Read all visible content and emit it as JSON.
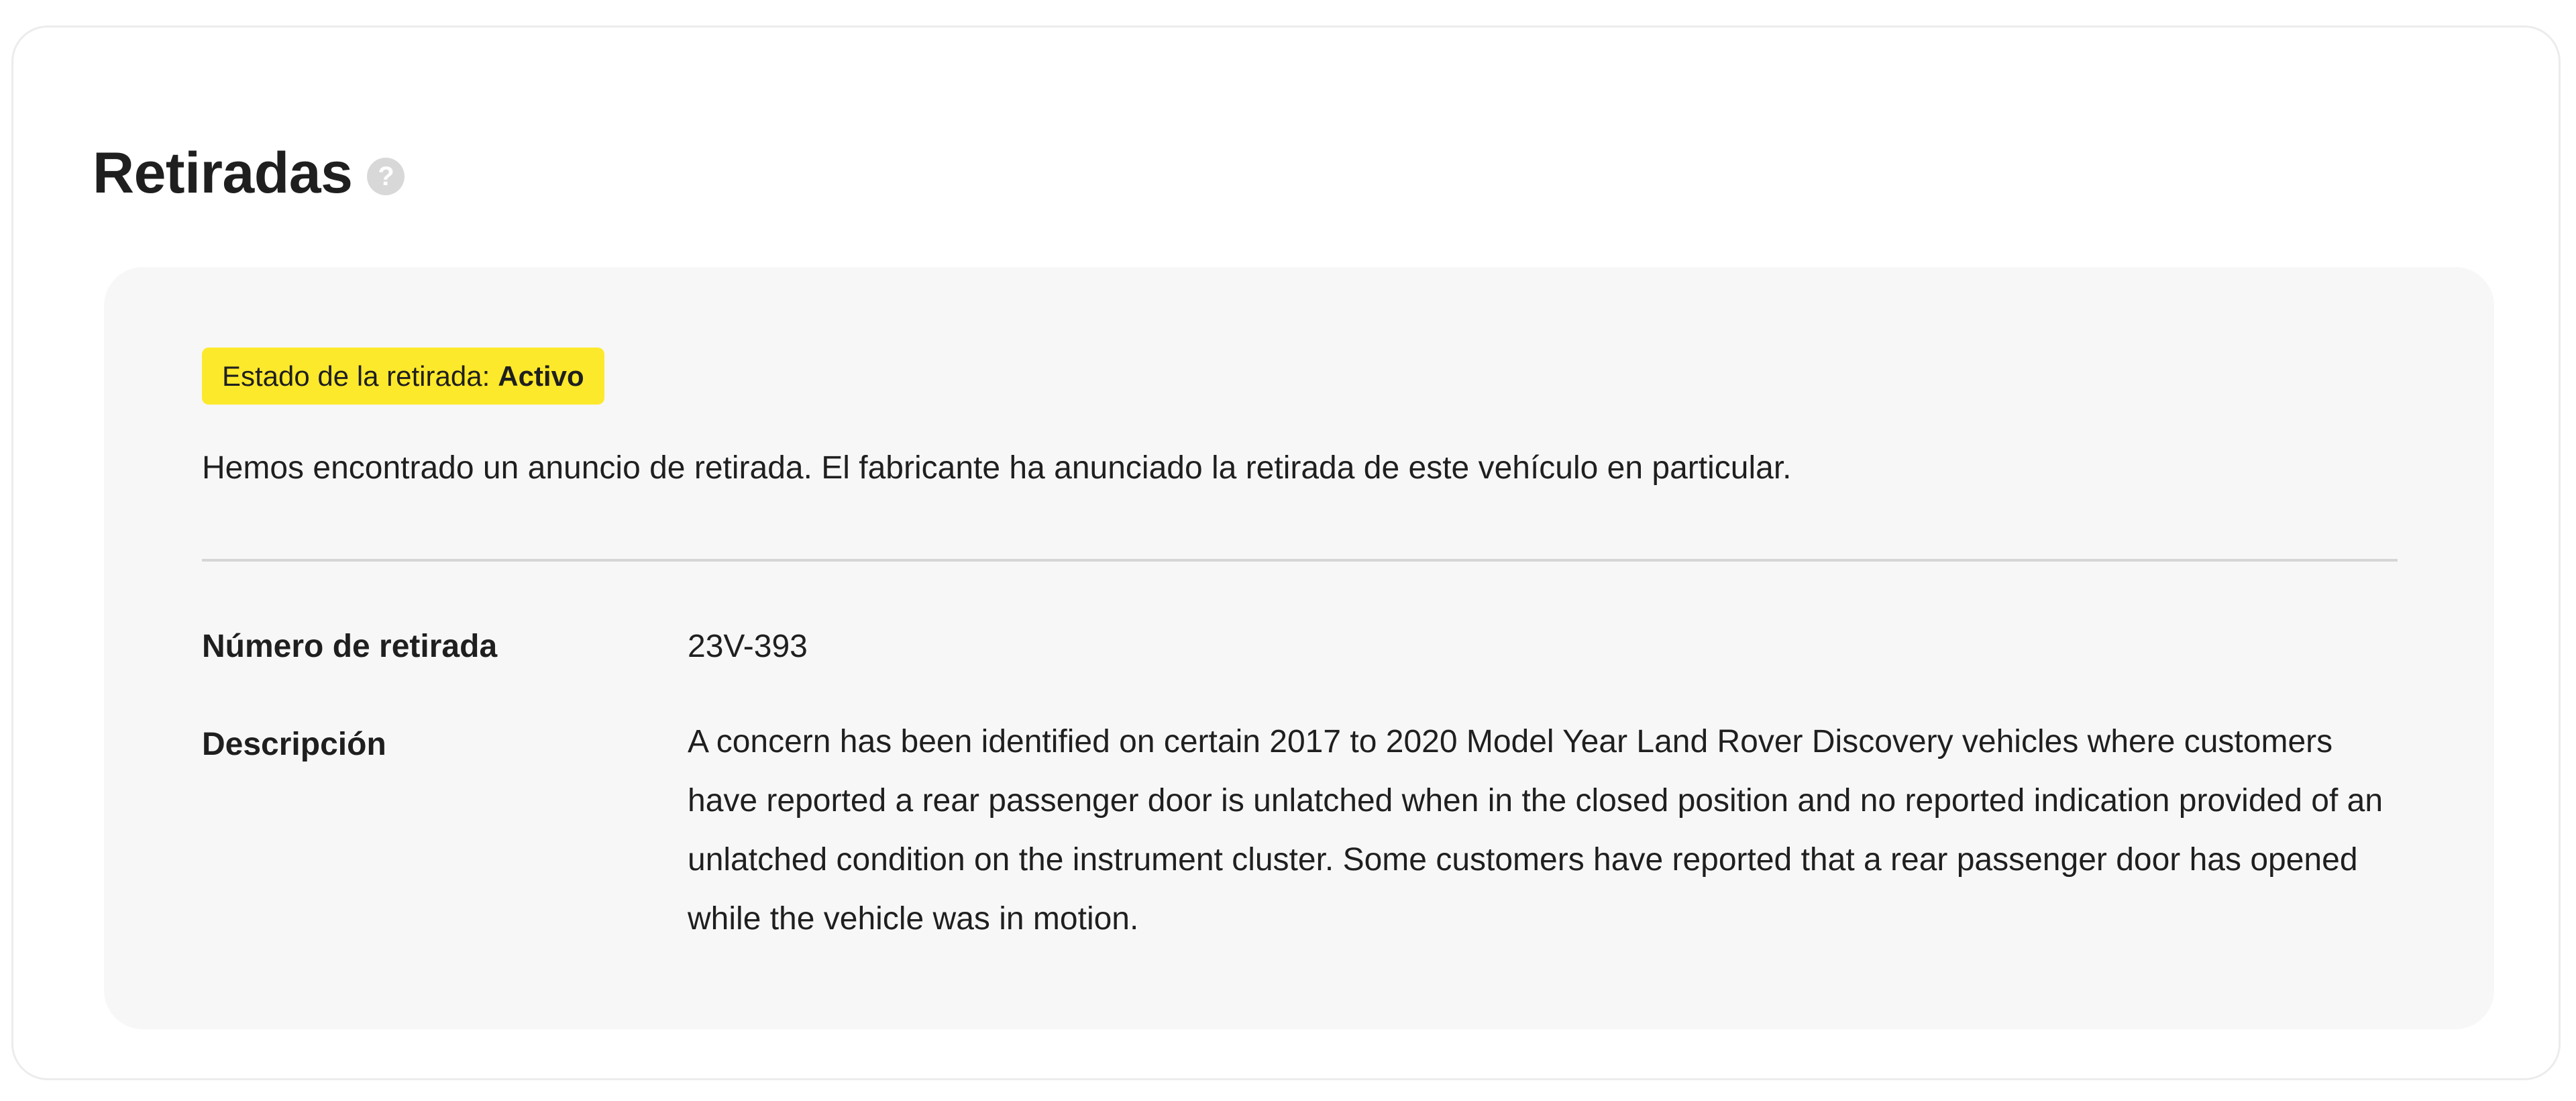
{
  "section": {
    "title": "Retiradas",
    "help_icon": "question-mark-icon"
  },
  "recall": {
    "status_label": "Estado de la retirada:",
    "status_value": "Activo",
    "intro": "Hemos encontrado un anuncio de retirada. El fabricante ha anunciado la retirada de este vehículo en particular.",
    "fields": {
      "number_label": "Número de retirada",
      "number_value": "23V-393",
      "description_label": "Descripción",
      "description_value": "A concern has been identified on certain 2017 to 2020 Model Year Land Rover Discovery vehicles where customers have reported a rear passenger door is unlatched when in the closed position and no reported indication provided of an unlatched condition on the instrument cluster. Some customers have reported that a rear passenger door has opened while the vehicle was in motion."
    }
  },
  "colors": {
    "badge_bg": "#fde92b",
    "panel_bg": "#f7f7f7",
    "text": "#1f1f1f"
  }
}
